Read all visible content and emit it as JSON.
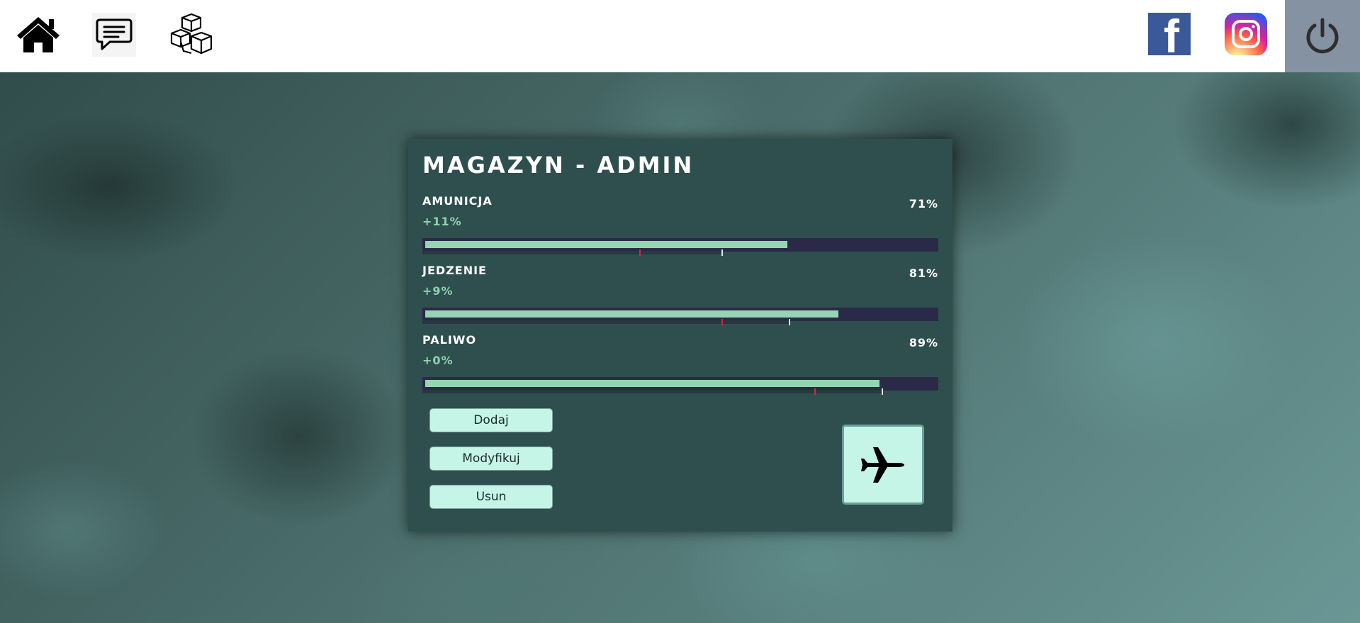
{
  "nav": {
    "icons": [
      "home-icon",
      "chat-icon",
      "boxes-icon"
    ],
    "social": [
      "facebook-icon",
      "instagram-icon"
    ],
    "power_icon": "power-icon",
    "facebook_glyph": "f"
  },
  "panel": {
    "title": "MAGAZYN - ADMIN",
    "stats": [
      {
        "name": "AMUNICJA",
        "change": "+11%",
        "percent_label": "71%",
        "fill": 0.71,
        "red_mark": 0.42,
        "white_mark": 0.58
      },
      {
        "name": "JEDZENIE",
        "change": "+9%",
        "percent_label": "81%",
        "fill": 0.81,
        "red_mark": 0.58,
        "white_mark": 0.71
      },
      {
        "name": "PALIWO",
        "change": "+0%",
        "percent_label": "89%",
        "fill": 0.89,
        "red_mark": 0.76,
        "white_mark": 0.89
      }
    ],
    "buttons": {
      "add": "Dodaj",
      "modify": "Modyfikuj",
      "delete": "Usun"
    },
    "action_icon": "airplane-icon"
  },
  "colors": {
    "panel_bg": "#2f4f4f",
    "bar_fill": "#96d4b4",
    "bar_track": "#2a2a48",
    "change_text": "#8fd1ae",
    "button_bg": "#c4f5e6",
    "power_bg": "#8592a2",
    "facebook": "#3b5998"
  }
}
